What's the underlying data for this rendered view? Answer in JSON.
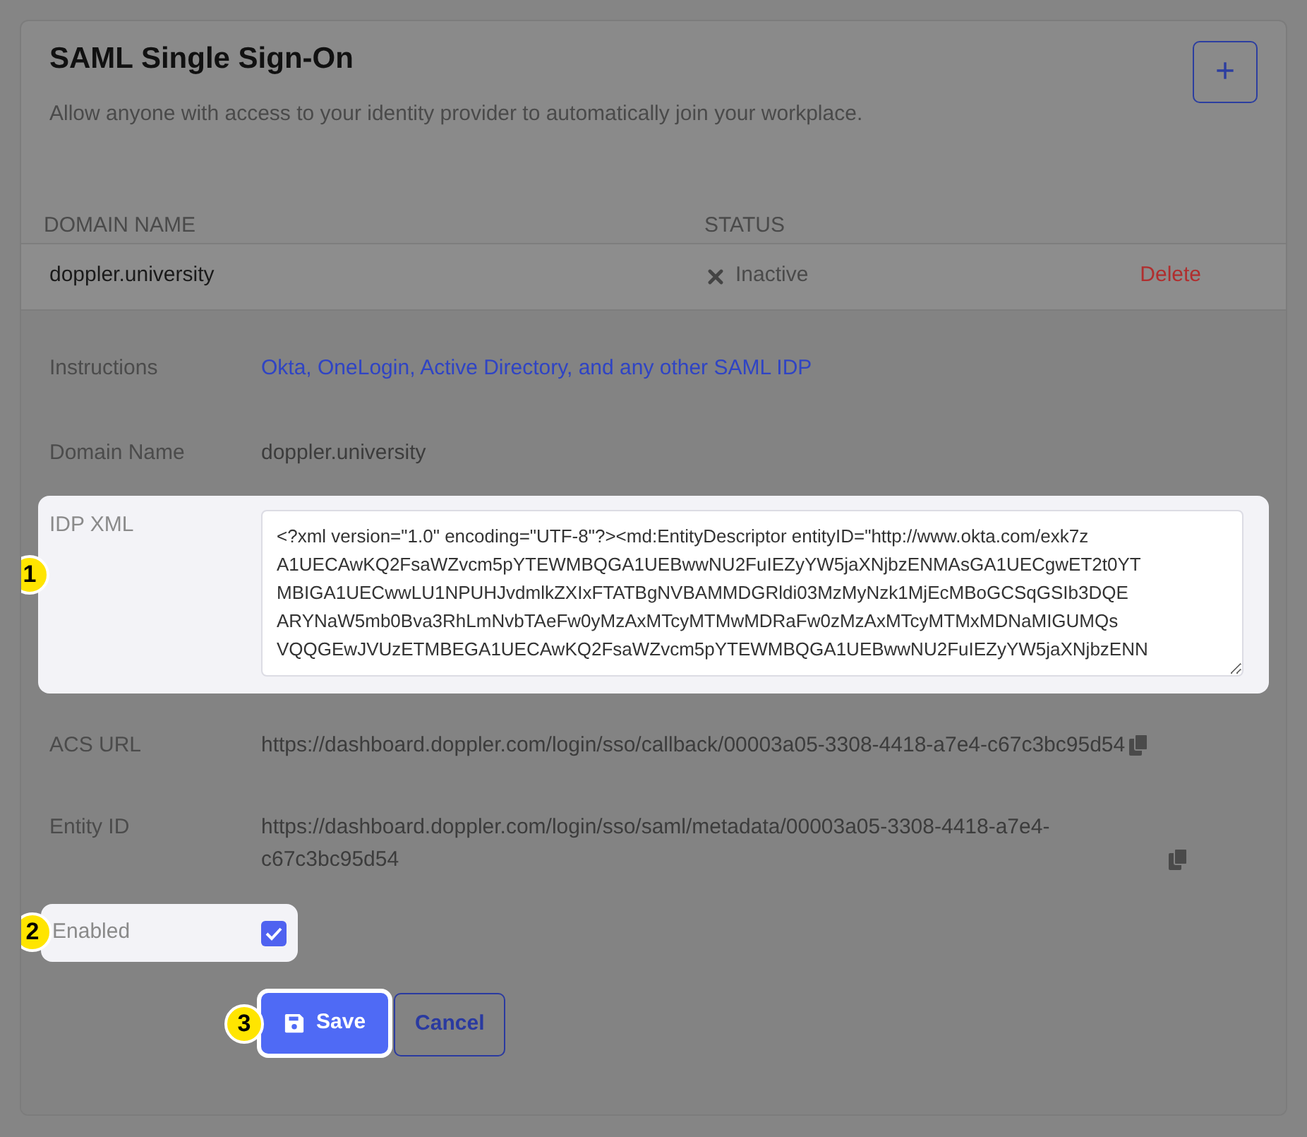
{
  "card": {
    "title": "SAML Single Sign-On",
    "description": "Allow anyone with access to your identity provider to automatically join your workplace.",
    "add_button": "+"
  },
  "table": {
    "columns": [
      "DOMAIN NAME",
      "STATUS"
    ],
    "rows": [
      {
        "domain": "doppler.university",
        "status": "Inactive",
        "action": "Delete"
      }
    ]
  },
  "details": [
    {
      "kind": "link",
      "label": "Instructions",
      "value": "Okta, OneLogin, Active Directory, and any other SAML IDP"
    },
    {
      "kind": "text",
      "label": "Domain Name",
      "value": "doppler.university"
    },
    {
      "kind": "textarea",
      "label": "IDP XML",
      "marker": "1",
      "lines": [
        "<?xml version=\"1.0\" encoding=\"UTF-8\"?><md:EntityDescriptor entityID=\"http://www.okta.com/exk7z",
        "A1UECAwKQ2FsaWZvcm5pYTEWMBQGA1UEBwwNU2FuIEZyYW5jaXNjbzENMAsGA1UECgwET2t0YT",
        "MBIGA1UECwwLU1NPUHJvdmlkZXIxFTATBgNVBAMMDGRldi03MzMyNzk1MjEcMBoGCSqGSIb3DQE",
        "ARYNaW5mb0Bva3RhLmNvbTAeFw0yMzAxMTcyMTMwMDRaFw0zMzAxMTcyMTMxMDNaMIGUMQs",
        "VQQGEwJVUzETMBEGA1UECAwKQ2FsaWZvcm5pYTEWMBQGA1UEBwwNU2FuIEZyYW5jaXNjbzENN"
      ]
    },
    {
      "kind": "copy",
      "label": "ACS URL",
      "value": "https://dashboard.doppler.com/login/sso/callback/00003a05-3308-4418-a7e4-c67c3bc95d54"
    },
    {
      "kind": "copy",
      "label": "Entity ID",
      "value": "https://dashboard.doppler.com/login/sso/saml/metadata/00003a05-3308-4418-a7e4-c67c3bc95d54"
    }
  ],
  "enabled": {
    "label": "Enabled",
    "checked": true,
    "marker": "2"
  },
  "buttons": {
    "save": "Save",
    "save_marker": "3",
    "cancel": "Cancel"
  }
}
